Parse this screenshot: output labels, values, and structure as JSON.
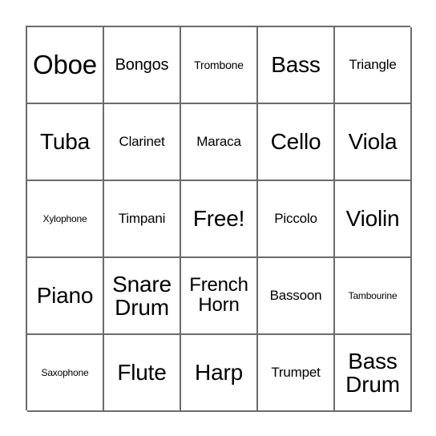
{
  "card": {
    "type": "bingo-card",
    "rows": 5,
    "columns": 5,
    "free_space_index": 12,
    "colors": {
      "border": "#6b6b6b",
      "text": "#000000",
      "background": "#ffffff"
    },
    "cells": [
      {
        "text": "Oboe",
        "size": "3xl"
      },
      {
        "text": "Bongos",
        "size": "l"
      },
      {
        "text": "Trombone",
        "size": "s"
      },
      {
        "text": "Bass",
        "size": "xxl"
      },
      {
        "text": "Triangle",
        "size": "m"
      },
      {
        "text": "Tuba",
        "size": "xxl"
      },
      {
        "text": "Clarinet",
        "size": "m"
      },
      {
        "text": "Maraca",
        "size": "m"
      },
      {
        "text": "Cello",
        "size": "xxl"
      },
      {
        "text": "Viola",
        "size": "xxl"
      },
      {
        "text": "Xylophone",
        "size": "xs"
      },
      {
        "text": "Timpani",
        "size": "m"
      },
      {
        "text": "Free!",
        "size": "xxl"
      },
      {
        "text": "Piccolo",
        "size": "m"
      },
      {
        "text": "Violin",
        "size": "xxl"
      },
      {
        "text": "Piano",
        "size": "xxl"
      },
      {
        "text": "Snare\nDrum",
        "size": "xxl"
      },
      {
        "text": "French\nHorn",
        "size": "xl"
      },
      {
        "text": "Bassoon",
        "size": "m"
      },
      {
        "text": "Tambourine",
        "size": "xs"
      },
      {
        "text": "Saxophone",
        "size": "xs"
      },
      {
        "text": "Flute",
        "size": "xxl"
      },
      {
        "text": "Harp",
        "size": "xxl"
      },
      {
        "text": "Trumpet",
        "size": "m"
      },
      {
        "text": "Bass\nDrum",
        "size": "xxl"
      }
    ]
  }
}
